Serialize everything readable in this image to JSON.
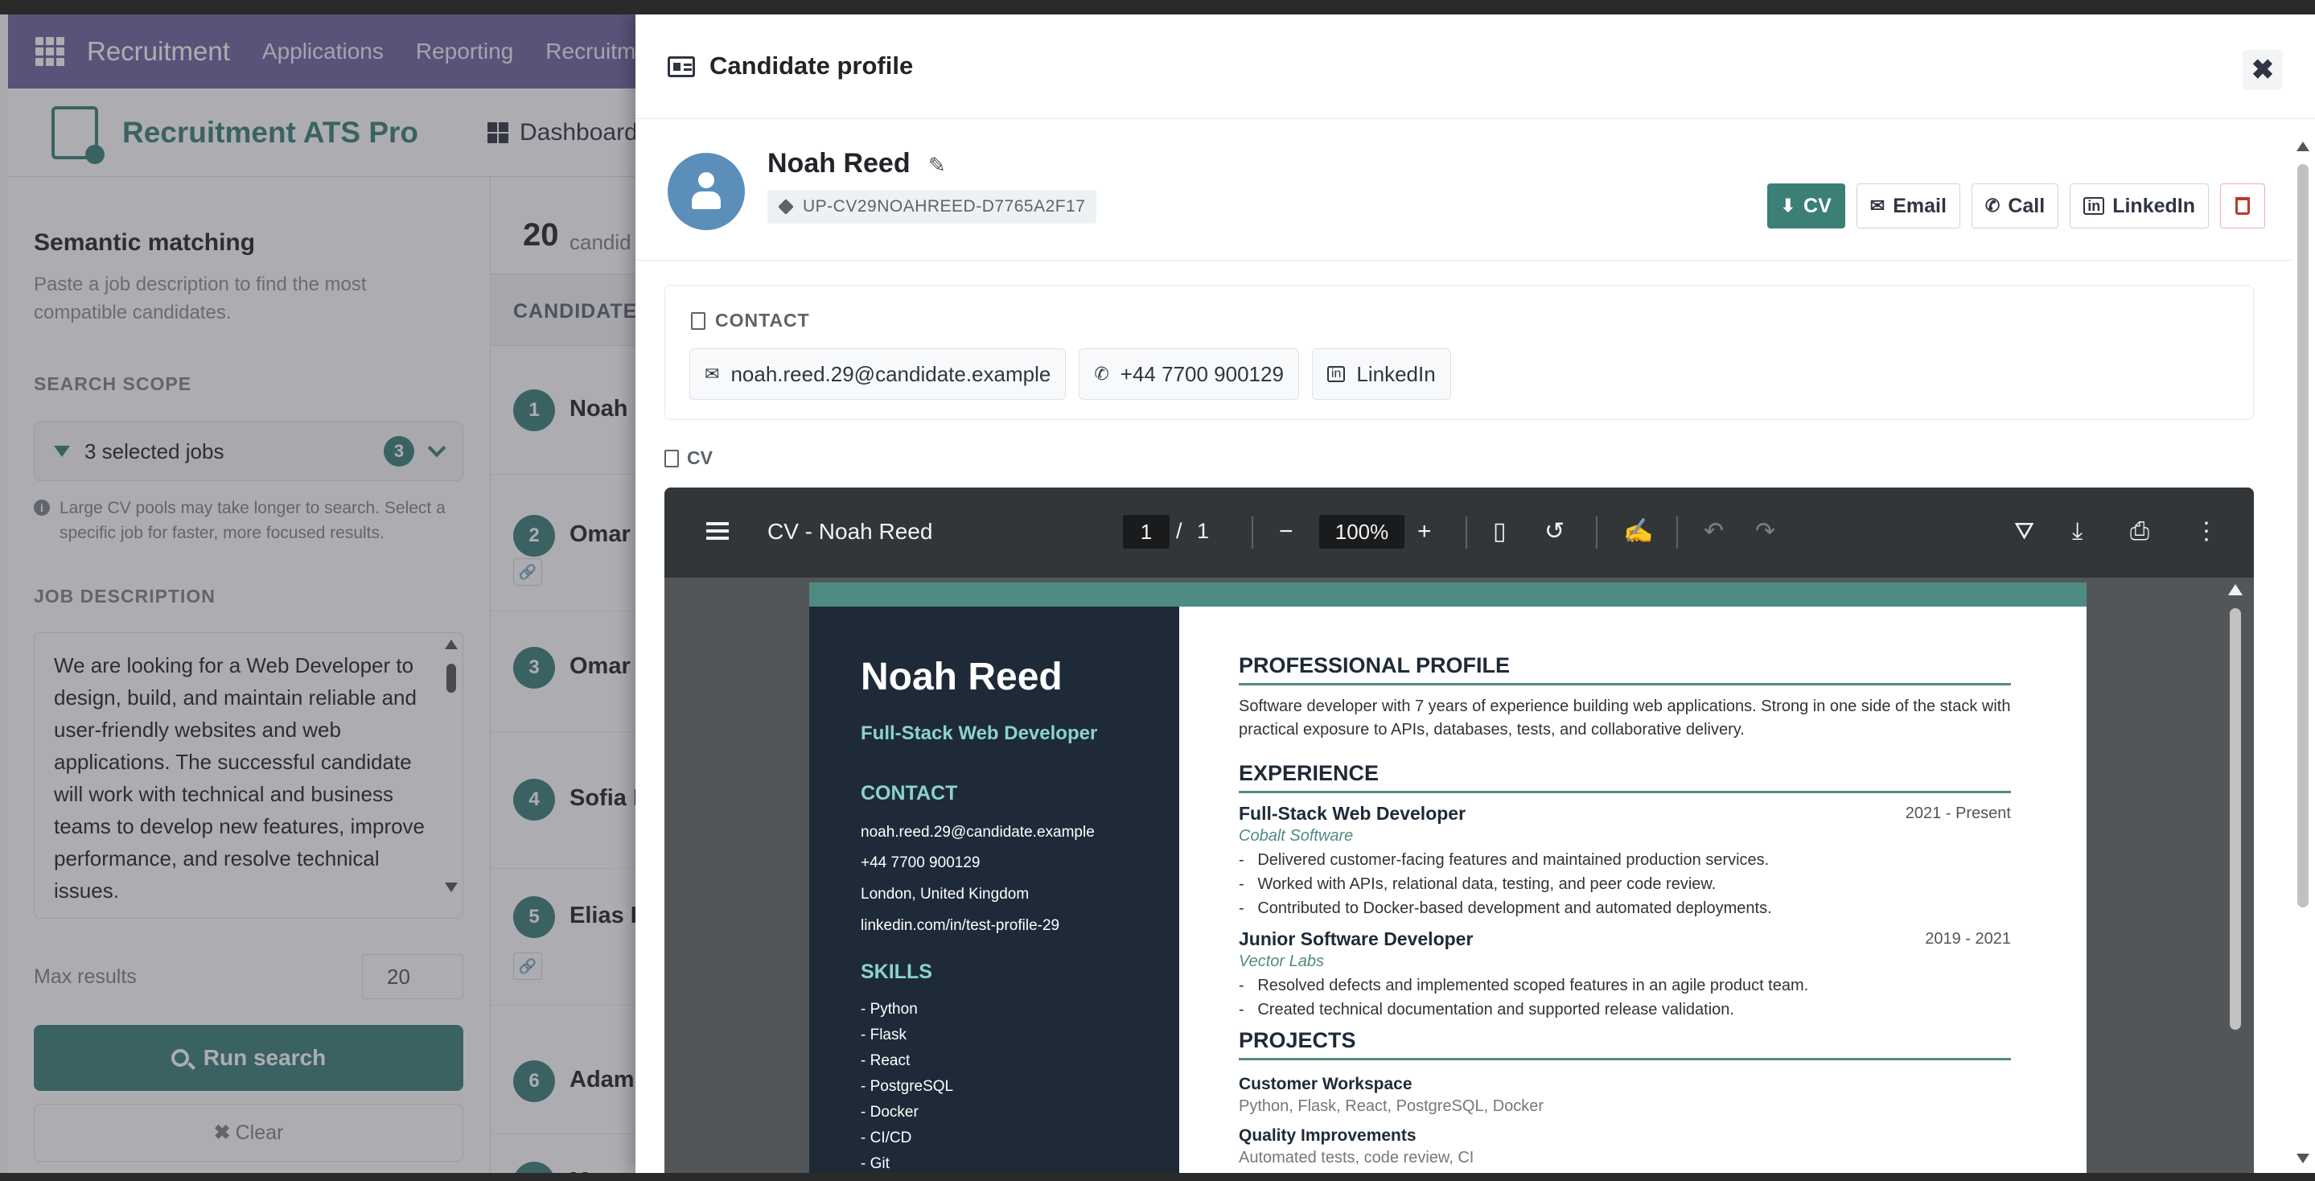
{
  "topnav": {
    "brand": "Recruitment",
    "items": [
      "Applications",
      "Reporting",
      "Recruitm"
    ]
  },
  "subnav": {
    "app_name": "Recruitment ATS Pro",
    "dashboard": "Dashboard"
  },
  "left_panel": {
    "title": "Semantic matching",
    "subtitle": "Paste a job description to find the most compatible candidates.",
    "scope_label": "SEARCH SCOPE",
    "scope_value": "3 selected jobs",
    "scope_count": "3",
    "hint": "Large CV pools may take longer to search. Select a specific job for faster, more focused results.",
    "jd_label": "JOB DESCRIPTION",
    "job_description": "We are looking for a Web Developer to design, build, and maintain reliable and user-friendly websites and web applications. The successful candidate will work with technical and business teams to develop new features, improve performance, and resolve technical issues.",
    "max_results_label": "Max results",
    "max_results": "20",
    "run_label": "Run search",
    "clear_label": "Clear"
  },
  "results": {
    "count": "20",
    "count_label": "candid",
    "column_header": "CANDIDATE",
    "rows": [
      {
        "rank": "1",
        "name": "Noah"
      },
      {
        "rank": "2",
        "name": "Omar"
      },
      {
        "rank": "3",
        "name": "Omar"
      },
      {
        "rank": "4",
        "name": "Sofia I"
      },
      {
        "rank": "5",
        "name": "Elias I"
      },
      {
        "rank": "6",
        "name": "Adam"
      },
      {
        "rank": "7",
        "name": "M"
      }
    ]
  },
  "drawer": {
    "title": "Candidate profile",
    "name": "Noah Reed",
    "tag": "UP-CV29NOAHREED-D7765A2F17",
    "actions": {
      "cv": "CV",
      "email": "Email",
      "call": "Call",
      "linkedin": "LinkedIn"
    },
    "contact_header": "CONTACT",
    "contact": {
      "email": "noah.reed.29@candidate.example",
      "phone": "+44 7700 900129",
      "linkedin": "LinkedIn"
    },
    "cv_label": "CV"
  },
  "viewer": {
    "title": "CV - Noah Reed",
    "page": "1",
    "page_sep": "/",
    "total_pages": "1",
    "zoom": "100%"
  },
  "cv": {
    "name": "Noah Reed",
    "role": "Full-Stack Web Developer",
    "contact_heading": "CONTACT",
    "contact_lines": [
      "noah.reed.29@candidate.example",
      "+44 7700 900129",
      "London, United Kingdom",
      "linkedin.com/in/test-profile-29"
    ],
    "skills_heading": "SKILLS",
    "skills": [
      "- Python",
      "- Flask",
      "- React",
      "- PostgreSQL",
      "- Docker",
      "- CI/CD",
      "- Git"
    ],
    "profile_heading": "PROFESSIONAL PROFILE",
    "profile_text": "Software developer with 7 years of experience building web applications. Strong in one side of the stack with practical exposure to APIs, databases, tests, and collaborative delivery.",
    "experience_heading": "EXPERIENCE",
    "jobs": [
      {
        "title": "Full-Stack Web Developer",
        "dates": "2021 - Present",
        "company": "Cobalt Software",
        "bullets": [
          "Delivered customer-facing features and maintained production services.",
          "Worked with APIs, relational data, testing, and peer code review.",
          "Contributed to Docker-based development and automated deployments."
        ]
      },
      {
        "title": "Junior Software Developer",
        "dates": "2019 - 2021",
        "company": "Vector Labs",
        "bullets": [
          "Resolved defects and implemented scoped features in an agile product team.",
          "Created technical documentation and supported release validation."
        ]
      }
    ],
    "projects_heading": "PROJECTS",
    "projects": [
      {
        "title": "Customer Workspace",
        "stack": "Python, Flask, React, PostgreSQL, Docker"
      },
      {
        "title": "Quality Improvements",
        "stack": "Automated tests, code review, CI"
      }
    ]
  }
}
